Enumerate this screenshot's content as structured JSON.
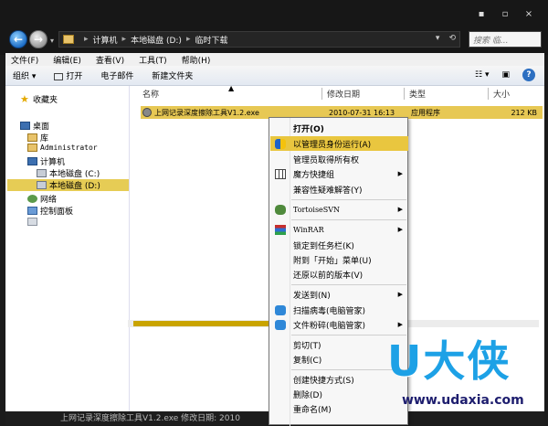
{
  "window": {
    "minimize": "▪",
    "maximize": "▫",
    "close": "×"
  },
  "address": {
    "crumbs": [
      "计算机",
      "本地磁盘 (D:)",
      "临时下载"
    ],
    "search_placeholder": "搜索 临..."
  },
  "menubar": [
    "文件(F)",
    "编辑(E)",
    "查看(V)",
    "工具(T)",
    "帮助(H)"
  ],
  "toolbar": {
    "organize": "组织 ▾",
    "open": "打开",
    "email": "电子邮件",
    "new_folder": "新建文件夹",
    "help": "?"
  },
  "nav": {
    "favorites": "收藏夹",
    "desktop": "桌面",
    "library": "库",
    "user": "Administrator",
    "computer": "计算机",
    "disk_c": "本地磁盘 (C:)",
    "disk_d": "本地磁盘 (D:)",
    "network": "网络",
    "control_panel": "控制面板"
  },
  "columns": {
    "name": "名称",
    "modified": "修改日期",
    "type": "类型",
    "size": "大小"
  },
  "file": {
    "name": "上网记录深度擦除工具V1.2.exe",
    "modified": "2010-07-31 16:13",
    "type": "应用程序",
    "size": "212 KB"
  },
  "context_menu": {
    "open": "打开(O)",
    "run_as_admin": "以管理员身份运行(A)",
    "take_ownership": "管理员取得所有权",
    "magic_group": "魔方快捷组",
    "compat": "兼容性疑难解答(Y)",
    "tortoise": "TortoiseSVN",
    "winrar": "WinRAR",
    "pin_taskbar": "锁定到任务栏(K)",
    "pin_start": "附到「开始」菜单(U)",
    "restore": "还原以前的版本(V)",
    "send_to": "发送到(N)",
    "scan": "扫描病毒(电脑管家)",
    "shred": "文件粉碎(电脑管家)",
    "cut": "剪切(T)",
    "copy": "复制(C)",
    "shortcut": "创建快捷方式(S)",
    "delete": "删除(D)",
    "rename": "重命名(M)"
  },
  "status": {
    "text": "上网记录深度擦除工具V1.2.exe  修改日期: 2010"
  },
  "watermark": {
    "logo": "U大侠",
    "url": "www.udaxia.com"
  },
  "colors": {
    "selection": "#e7c854",
    "menu_highlight": "#e9c63f",
    "watermark_blue": "#1da1e6"
  }
}
